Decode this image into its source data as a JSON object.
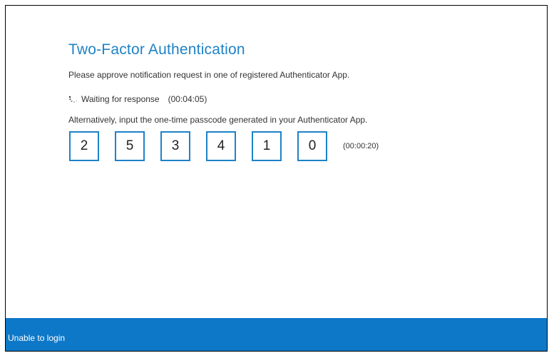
{
  "header": {
    "title": "Two-Factor Authentication"
  },
  "content": {
    "approve_text": "Please approve notification request in one of registered Authenticator App.",
    "waiting_text": "Waiting for response",
    "waiting_timer": "(00:04:05)",
    "alternative_text": "Alternatively, input the one-time passcode generated in your Authenticator App."
  },
  "passcode": {
    "digits": [
      "2",
      "5",
      "3",
      "4",
      "1",
      "0"
    ],
    "timer": "(00:00:20)"
  },
  "footer": {
    "link_label": "Unable to login"
  },
  "colors": {
    "accent": "#1e82c8",
    "footer_bg": "#0e78c8",
    "text": "#333333"
  },
  "icons": {
    "spinner": "loading-spinner-icon"
  }
}
